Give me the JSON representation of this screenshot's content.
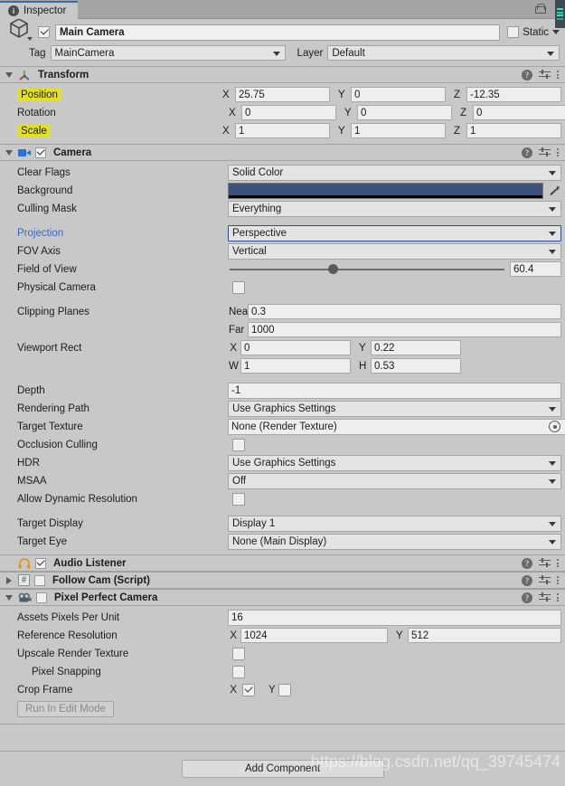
{
  "window": {
    "tab_label": "Inspector",
    "tab_icon": "info-icon",
    "lock_icon": "padlock-icon",
    "menu_icon": "kebab-menu-icon"
  },
  "gameobject": {
    "icon": "cube-icon",
    "enabled": true,
    "name": "Main Camera",
    "static_label": "Static",
    "static_checked": false,
    "tag_label": "Tag",
    "tag_value": "MainCamera",
    "layer_label": "Layer",
    "layer_value": "Default"
  },
  "components": [
    {
      "title": "Transform",
      "icon": "transform-axis-icon",
      "expanded": true,
      "has_checkbox": false
    },
    {
      "title": "Camera",
      "icon": "camera-icon",
      "expanded": true,
      "has_checkbox": true,
      "checked": true
    },
    {
      "title": "Audio Listener",
      "icon": "headphones-icon",
      "expanded": false,
      "has_checkbox": true,
      "checked": true
    },
    {
      "title": "Follow Cam (Script)",
      "icon": "script-hash-icon",
      "expanded": false,
      "has_checkbox": true,
      "checked": false
    },
    {
      "title": "Pixel Perfect Camera",
      "icon": "pixel-perfect-camera-icon",
      "expanded": true,
      "has_checkbox": true,
      "checked": false
    }
  ],
  "transform": {
    "position": {
      "label": "Position",
      "highlighted": true,
      "x": "25.75",
      "y": "0",
      "z": "-12.35"
    },
    "rotation": {
      "label": "Rotation",
      "highlighted": false,
      "x": "0",
      "y": "0",
      "z": "0"
    },
    "scale": {
      "label": "Scale",
      "highlighted": true,
      "x": "1",
      "y": "1",
      "z": "1"
    },
    "axis_x": "X",
    "axis_y": "Y",
    "axis_z": "Z"
  },
  "camera": {
    "clear_flags_label": "Clear Flags",
    "clear_flags_value": "Solid Color",
    "background_label": "Background",
    "background_color": "#3b527f",
    "background_alpha_color": "#000000",
    "eyedropper_icon": "eyedropper-icon",
    "culling_mask_label": "Culling Mask",
    "culling_mask_value": "Everything",
    "projection_label": "Projection",
    "projection_value": "Perspective",
    "projection_label_color": "#3a68c4",
    "fov_axis_label": "FOV Axis",
    "fov_axis_value": "Vertical",
    "field_of_view_label": "Field of View",
    "field_of_view_value": "60.4",
    "field_of_view_percent": 36,
    "physical_camera_label": "Physical Camera",
    "physical_camera_checked": false,
    "clipping_planes_label": "Clipping Planes",
    "near_label": "Near",
    "near_value": "0.3",
    "far_label": "Far",
    "far_value": "1000",
    "viewport_rect_label": "Viewport Rect",
    "viewport_x_label": "X",
    "viewport_x": "0",
    "viewport_y_label": "Y",
    "viewport_y": "0.22",
    "viewport_w_label": "W",
    "viewport_w": "1",
    "viewport_h_label": "H",
    "viewport_h": "0.53",
    "depth_label": "Depth",
    "depth_value": "-1",
    "rendering_path_label": "Rendering Path",
    "rendering_path_value": "Use Graphics Settings",
    "target_texture_label": "Target Texture",
    "target_texture_value": "None (Render Texture)",
    "occlusion_culling_label": "Occlusion Culling",
    "occlusion_culling_checked": false,
    "hdr_label": "HDR",
    "hdr_value": "Use Graphics Settings",
    "msaa_label": "MSAA",
    "msaa_value": "Off",
    "allow_dynamic_resolution_label": "Allow Dynamic Resolution",
    "allow_dynamic_resolution_checked": false,
    "target_display_label": "Target Display",
    "target_display_value": "Display 1",
    "target_eye_label": "Target Eye",
    "target_eye_value": "None (Main Display)"
  },
  "pixel_perfect": {
    "assets_ppu_label": "Assets Pixels Per Unit",
    "assets_ppu_value": "16",
    "reference_resolution_label": "Reference Resolution",
    "ref_x_label": "X",
    "ref_x_value": "1024",
    "ref_y_label": "Y",
    "ref_y_value": "512",
    "upscale_rt_label": "Upscale Render Texture",
    "upscale_rt_checked": false,
    "pixel_snapping_label": "Pixel Snapping",
    "pixel_snapping_checked": false,
    "crop_frame_label": "Crop Frame",
    "crop_x_label": "X",
    "crop_x_checked": true,
    "crop_y_label": "Y",
    "crop_y_checked": false,
    "run_in_edit_mode_label": "Run In Edit Mode"
  },
  "footer": {
    "add_component_label": "Add Component",
    "watermark": "https://blog.csdn.net/qq_39745474"
  }
}
